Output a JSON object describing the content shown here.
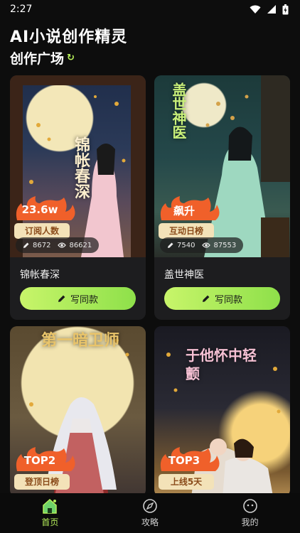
{
  "status": {
    "time": "2:27"
  },
  "app": {
    "title": "AI小说创作精灵"
  },
  "section": {
    "title": "创作广场"
  },
  "cards": [
    {
      "title": "锦帐春深",
      "poster_text": "锦帐春深",
      "badge_value": "23.6w",
      "badge_label": "订阅人数",
      "edits": "8672",
      "views": "86621",
      "button": "写同款"
    },
    {
      "title": "盖世神医",
      "poster_text": "盖世神医",
      "badge_value": "飙升",
      "badge_label": "互动日榜",
      "edits": "7540",
      "views": "87553",
      "button": "写同款"
    },
    {
      "title": "",
      "poster_text": "第一暗卫师",
      "badge_value": "TOP2",
      "badge_label": "登顶日榜"
    },
    {
      "title": "",
      "poster_text": "于他怀中轻颤",
      "badge_value": "TOP3",
      "badge_label": "上线5天"
    }
  ],
  "tabs": [
    {
      "label": "首页",
      "icon": "home-icon",
      "active": true
    },
    {
      "label": "攻略",
      "icon": "compass-icon",
      "active": false
    },
    {
      "label": "我的",
      "icon": "profile-icon",
      "active": false
    }
  ],
  "colors": {
    "accent": "#b6ef5b",
    "badge_flame": "#f0602a",
    "badge_label_bg": "#f3e2b8"
  }
}
